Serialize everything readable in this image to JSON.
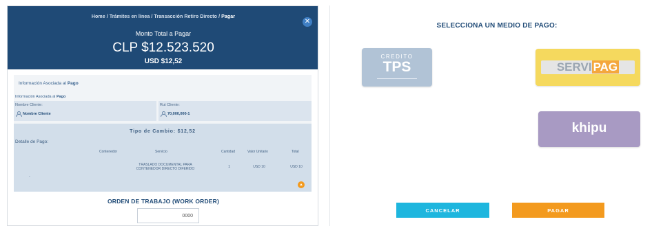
{
  "breadcrumb": {
    "items": [
      "Home",
      "Trámites en línea",
      "Transacción Retiro Directo"
    ],
    "current": "Pagar",
    "separator": "/"
  },
  "close_icon": "close-circle-icon",
  "header": {
    "total_label": "Monto Total a Pagar",
    "total_clp": "CLP $12.523.520",
    "total_usd": "USD $12,52"
  },
  "info": {
    "heading_prefix": "Información Asociada al ",
    "heading_strong": "Pago",
    "sub_prefix": "Información Asociada al ",
    "sub_strong": "Pago"
  },
  "client": {
    "name_label": "Nombre Cliente:",
    "name_value": "Nombre Cliente",
    "rut_label": "Rut Cliente:",
    "rut_value": "70,000,000-1",
    "icon": "user-icon"
  },
  "detail": {
    "exchange_rate": "Tipo de Cambio: $12,52",
    "label": "Detalle de Pago:",
    "columns": [
      "Contenedor",
      "Servicio",
      "Cantidad",
      "Valor Unitario",
      "Total"
    ],
    "rows": [
      {
        "container": "-",
        "service_line1": "TRASLADO DOCUMENTAL PARA",
        "service_line2": "CONTENEDOR DIRECTO DIFERIDO",
        "quantity": "1",
        "unit_value": "USD 10",
        "total": "USD 10"
      }
    ],
    "collapse_icon": "chevron-up-icon"
  },
  "work_order": {
    "title": "ORDEN DE TRABAJO (WORK ORDER)",
    "value": "0000"
  },
  "payment": {
    "title": "SELECCIONA UN MEDIO DE PAGO:",
    "tps": {
      "top": "CREDITO",
      "main": "TPS"
    },
    "servipag": {
      "part1": "SERVI",
      "part2": "PAG"
    },
    "khipu": {
      "label": "khipu"
    }
  },
  "buttons": {
    "cancel": "CANCELAR",
    "pay": "PAGAR"
  },
  "colors": {
    "header_bg": "#1f4a76",
    "cancel": "#1eb6de",
    "pay": "#f39a1e",
    "tps": "#b1c3d6",
    "servipag": "#f5d95e",
    "khipu": "#a89ac3"
  }
}
